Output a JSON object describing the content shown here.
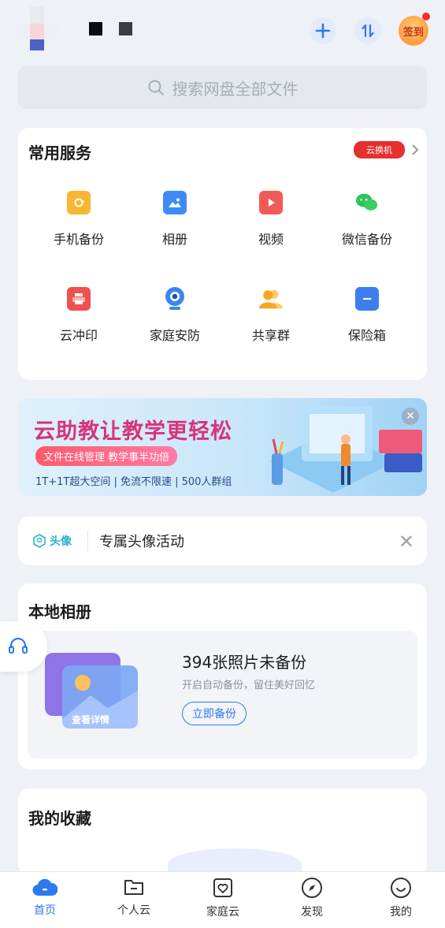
{
  "header": {
    "add_icon": "plus-icon",
    "transfer_icon": "transfer-arrows-icon",
    "checkin_label": "签到"
  },
  "search": {
    "placeholder": "搜索网盘全部文件",
    "icon": "search-icon"
  },
  "services": {
    "title": "常用服务",
    "promo_tag": "云换机",
    "items": [
      {
        "label": "手机备份",
        "icon": "phone-backup-icon",
        "color": "#f7b733"
      },
      {
        "label": "相册",
        "icon": "album-icon",
        "color": "#3e8bf5"
      },
      {
        "label": "视频",
        "icon": "video-icon",
        "color": "#f25a5a"
      },
      {
        "label": "微信备份",
        "icon": "wechat-icon",
        "color": "#2fc45a"
      },
      {
        "label": "云冲印",
        "icon": "printer-icon",
        "color": "#f0504e"
      },
      {
        "label": "家庭安防",
        "icon": "camera-icon",
        "color": "#3d86f0"
      },
      {
        "label": "共享群",
        "icon": "share-group-icon",
        "color": "#f6a623"
      },
      {
        "label": "保险箱",
        "icon": "safe-icon",
        "color": "#3e7ff0"
      }
    ]
  },
  "banner": {
    "title": "云助教让教学更轻松",
    "pill": "文件在线管理 教学事半功倍",
    "subtitle": "1T+1T超大空间 | 免流不限速 | 500人群组"
  },
  "activity": {
    "tag": "头像",
    "text": "专属头像活动"
  },
  "album": {
    "title": "本地相册",
    "count_text": "394张照片未备份",
    "hint": "开启自动备份，留住美好回忆",
    "button": "立即备份",
    "card_label": "查看详情"
  },
  "favorites": {
    "title": "我的收藏"
  },
  "nav": {
    "tabs": [
      {
        "label": "首页",
        "icon": "cloud-icon",
        "active": true
      },
      {
        "label": "个人云",
        "icon": "folder-icon",
        "active": false
      },
      {
        "label": "家庭云",
        "icon": "family-heart-icon",
        "active": false
      },
      {
        "label": "发现",
        "icon": "compass-icon",
        "active": false
      },
      {
        "label": "我的",
        "icon": "smile-icon",
        "active": false
      }
    ]
  },
  "colors": {
    "accent": "#2d7af0",
    "promo": "#e62f2f"
  }
}
